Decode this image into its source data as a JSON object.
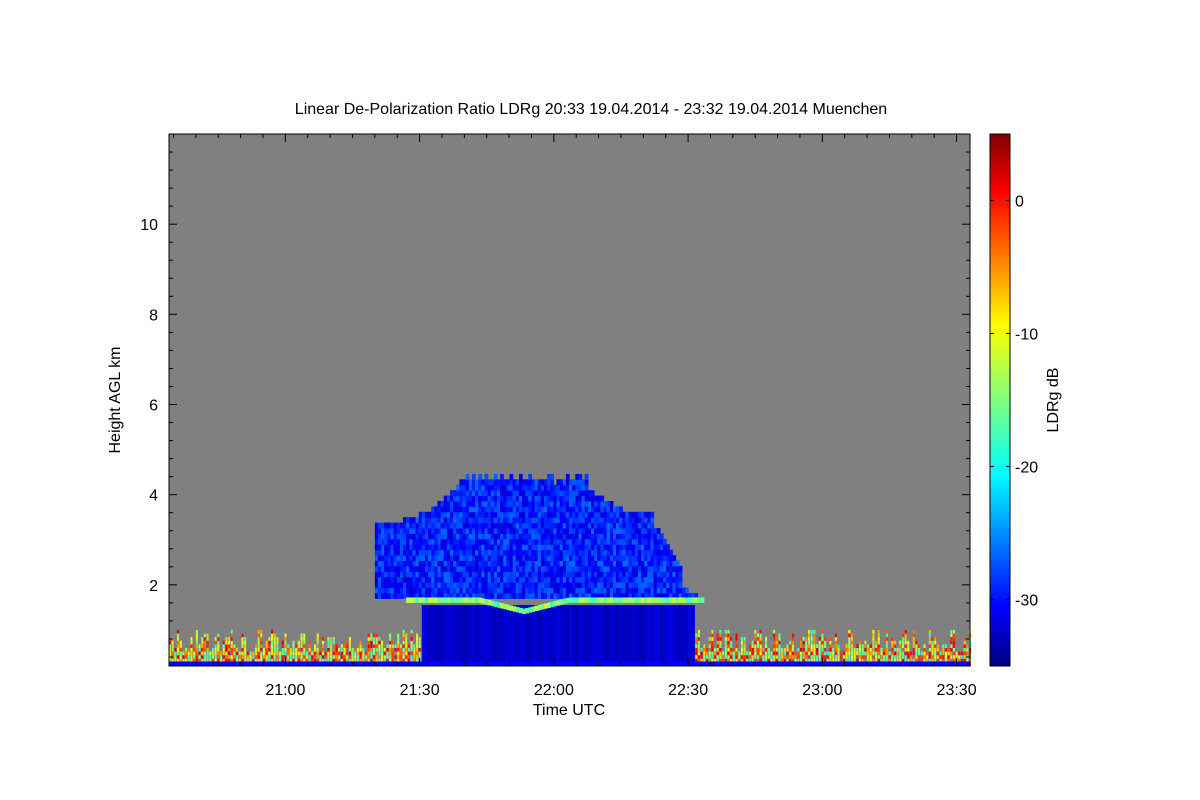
{
  "chart_data": {
    "type": "heatmap",
    "title": "Linear De-Polarization Ratio LDRg   20:33 19.04.2014 - 23:32 19.04.2014 Muenchen",
    "xlabel": "Time UTC",
    "ylabel": "Height AGL km",
    "x_ticks": [
      "21:00",
      "21:30",
      "22:00",
      "22:30",
      "23:00",
      "23:30"
    ],
    "x_tick_values_min": [
      1260,
      1290,
      1320,
      1350,
      1380,
      1410
    ],
    "xlim_min": [
      1234,
      1413
    ],
    "y_ticks": [
      "2",
      "4",
      "6",
      "8",
      "10"
    ],
    "y_tick_values": [
      2,
      4,
      6,
      8,
      10
    ],
    "ylim": [
      0.2,
      12
    ],
    "colorbar": {
      "label": "LDRg dB",
      "ticks": [
        "0",
        "-10",
        "-20",
        "-30"
      ],
      "tick_values": [
        0,
        -10,
        -20,
        -30
      ],
      "range": [
        -35,
        5
      ],
      "colormap": "jet"
    },
    "background_color": "#808080",
    "features": [
      {
        "name": "cloud",
        "t_start_min": 1280,
        "t_end_min": 1358,
        "top_km": 4.4,
        "base_km": 0.3,
        "ldr_db": -30
      },
      {
        "name": "melting layer",
        "t_start_min": 1287,
        "t_end_min": 1353,
        "height_km": 1.6,
        "ldr_db": -15
      },
      {
        "name": "near-surface clutter",
        "t_start_min": 1234,
        "t_end_min": 1413,
        "top_km": 1.0,
        "ldr_db": -8
      }
    ]
  }
}
